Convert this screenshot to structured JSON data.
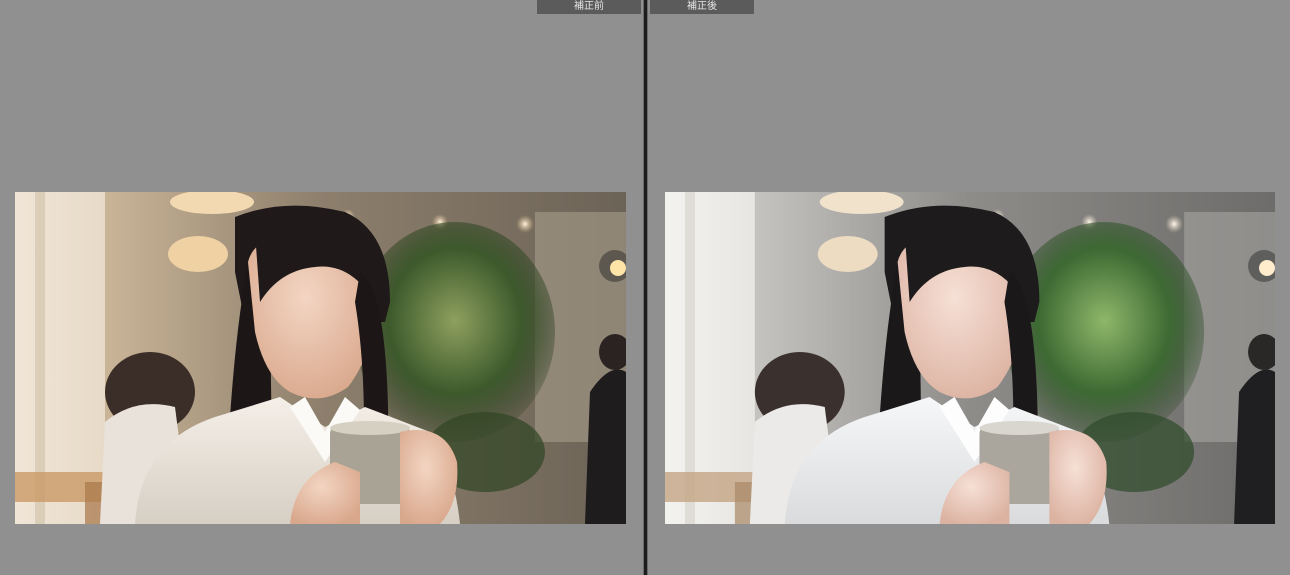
{
  "view": {
    "before_label": "補正前",
    "after_label": "補正後"
  },
  "colors": {
    "canvas": "#909090",
    "divider": "#1d1d1d",
    "label_bg": "#5b5b5b",
    "label_text": "#e6e6e6"
  }
}
